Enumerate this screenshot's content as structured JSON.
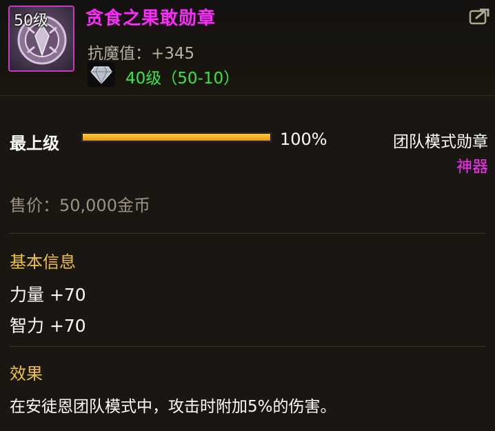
{
  "item": {
    "level_badge": "50级",
    "name": "贪食之果敢勋章",
    "stat": "抗魔值：+345",
    "gem_text": "40级（50-10）",
    "icon": "medal-icon",
    "gem_icon": "diamond-icon"
  },
  "progress": {
    "label": "最上级",
    "value_text": "100%",
    "fraction": 1.0
  },
  "classification": {
    "type": "团队模式勋章",
    "rarity": "神器"
  },
  "price": "售价：50,000金币",
  "basic_info": {
    "title": "基本信息",
    "attributes": [
      "力量 +70",
      "智力 +70"
    ]
  },
  "effect": {
    "title": "效果",
    "text": "在安徒恩团队模式中，攻击时附加5%的伤害。"
  },
  "colors": {
    "name": "#ff2bff",
    "gem_text": "#3fe63f",
    "section_title": "#f0c040",
    "progress_fill": "#f0b020"
  }
}
